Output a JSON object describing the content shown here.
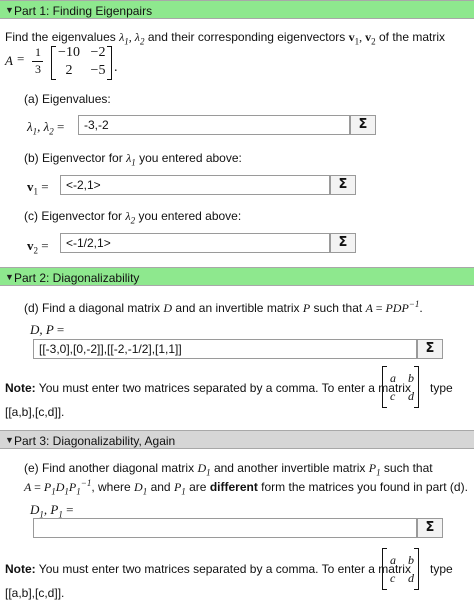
{
  "part1": {
    "header": "Part 1: Finding Eigenpairs",
    "intro_text": "Find the eigenvalues",
    "intro_mid": "and their corresponding eigenvectors",
    "intro_end": "of the matrix",
    "matrix_scalar_num": "1",
    "matrix_scalar_den": "3",
    "matrix": [
      [
        "−10",
        "−2"
      ],
      [
        "2",
        "−5"
      ]
    ],
    "a_label": "(a) Eigenvalues:",
    "eigenvalues_value": "-3,-2",
    "b_label": "(b) Eigenvector for",
    "b_label_end": "you entered above:",
    "v1_value": "<-2,1>",
    "c_label": "(c) Eigenvector for",
    "c_label_end": "you entered above:",
    "v2_value": "<-1/2,1>"
  },
  "part2": {
    "header": "Part 2: Diagonalizability",
    "d_text_a": "(d) Find a diagonal matrix",
    "d_text_b": "and an invertible matrix",
    "d_text_c": "such that",
    "dp_value": "[[-3,0],[0,-2]],[[-2,-1/2],[1,1]]",
    "note_label": "Note:",
    "note_text": "You must enter two matrices separated by a comma. To enter a matrix",
    "note_type": "type",
    "note_format": "[[a,b],[c,d]]."
  },
  "part3": {
    "header": "Part 3: Diagonalizability, Again",
    "e_text_a": "(e) Find another diagonal matrix",
    "e_text_b": "and another invertible matrix",
    "e_text_c": "such that",
    "e_text_d": ", where",
    "e_text_e": "and",
    "e_text_f": "are",
    "e_bold": "different",
    "e_text_g": "form the matrices you found in part (d).",
    "d1p1_value": "",
    "note_label": "Note:",
    "note_text": "You must enter two matrices separated by a comma. To enter a matrix",
    "note_type": "type",
    "note_format": "[[a,b],[c,d]]."
  },
  "sigma_symbol": "Σ",
  "collapse_icon": "triangle-down-icon",
  "colors": {
    "part_header_active": "#8ee88e",
    "part_header_inactive": "#d6d6d6"
  }
}
